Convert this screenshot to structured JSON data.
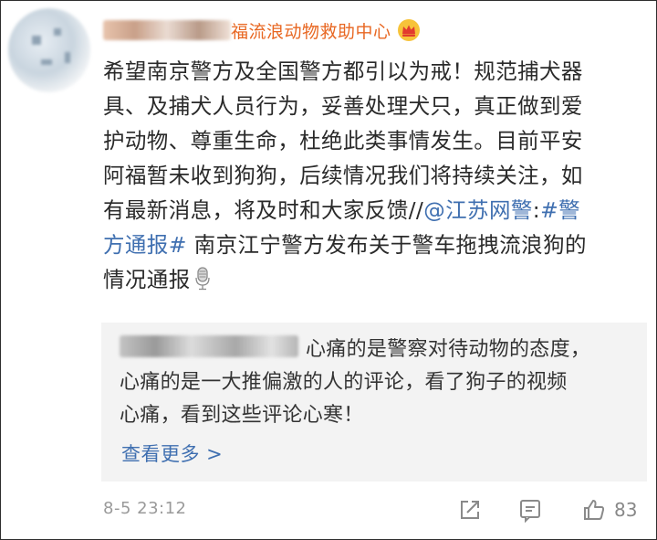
{
  "post": {
    "username_visible": "福流浪动物救助中心",
    "crown_icon": "crown-icon",
    "body_lines": [
      "希望南京警方及全国警方都引以为戒！规范捕犬器",
      "具、及捕犬人员行为，妥善处理犬只，真正做到爱",
      "护动物、尊重生命，杜绝此类事情发生。目前平安",
      "阿福暂未收到狗狗，后续情况我们将持续关注，如",
      "有最新消息，将及时和大家反馈//"
    ],
    "mention": "@江苏网警",
    "colon": ":",
    "hashtag_part1": "#警",
    "hashtag_part2": "方通报#",
    "line6_rest": "南京江宁警方发布关于警车拖拽流浪狗的",
    "line7": "情况通报",
    "mic_icon": "microphone-icon"
  },
  "quote": {
    "line1_rest": "心痛的是警察对待动物的态度，",
    "line2": "心痛的是一大推偏激的人的评论，看了狗子的视频",
    "line3": "心痛，看到这些评论心寒！",
    "more_label": "查看更多 >"
  },
  "footer": {
    "timestamp": "8-5 23:12",
    "like_count": "83"
  },
  "colors": {
    "username": "#e86722",
    "link": "#3f6fb0",
    "text": "#2a2a2a",
    "quote_bg": "#f3f3f3",
    "meta": "#9a9a9a"
  }
}
